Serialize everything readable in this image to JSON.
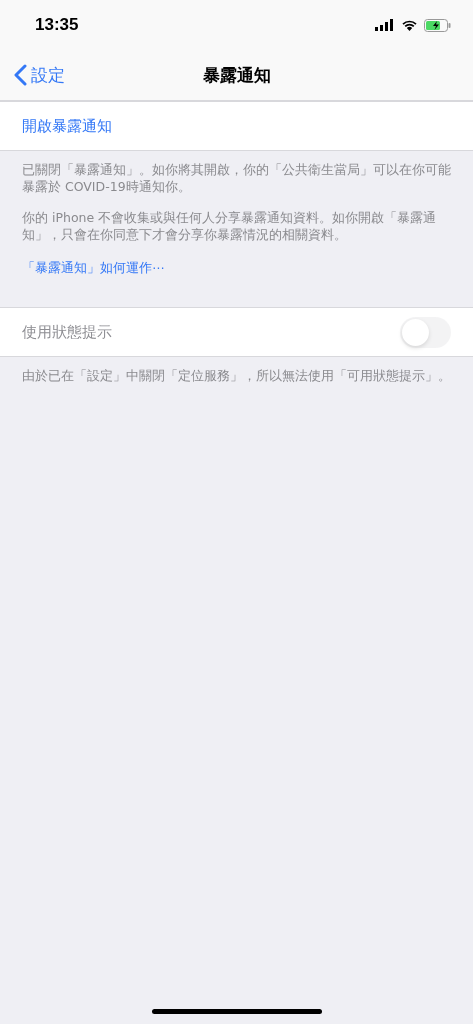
{
  "status_bar": {
    "time": "13:35"
  },
  "nav": {
    "back": "設定",
    "title": "暴露通知"
  },
  "sections": [
    {
      "row": {
        "kind": "action",
        "label": "開啟暴露通知"
      },
      "footer": [
        "已關閉「暴露通知」。如你將其開啟，你的「公共衛生當局」可以在你可能暴露於 COVID-19時通知你。",
        "你的 iPhone 不會收集或與任何人分享暴露通知資料。如你開啟「暴露通知」，只會在你同意下才會分享你暴露情況的相關資料。"
      ],
      "link": "「暴露通知」如何運作⋯"
    },
    {
      "row": {
        "kind": "toggle",
        "label": "使用狀態提示",
        "on": false,
        "disabled": true
      },
      "footer": [
        "由於已在「設定」中關閉「定位服務」，所以無法使用「可用狀態提示」。"
      ]
    }
  ]
}
